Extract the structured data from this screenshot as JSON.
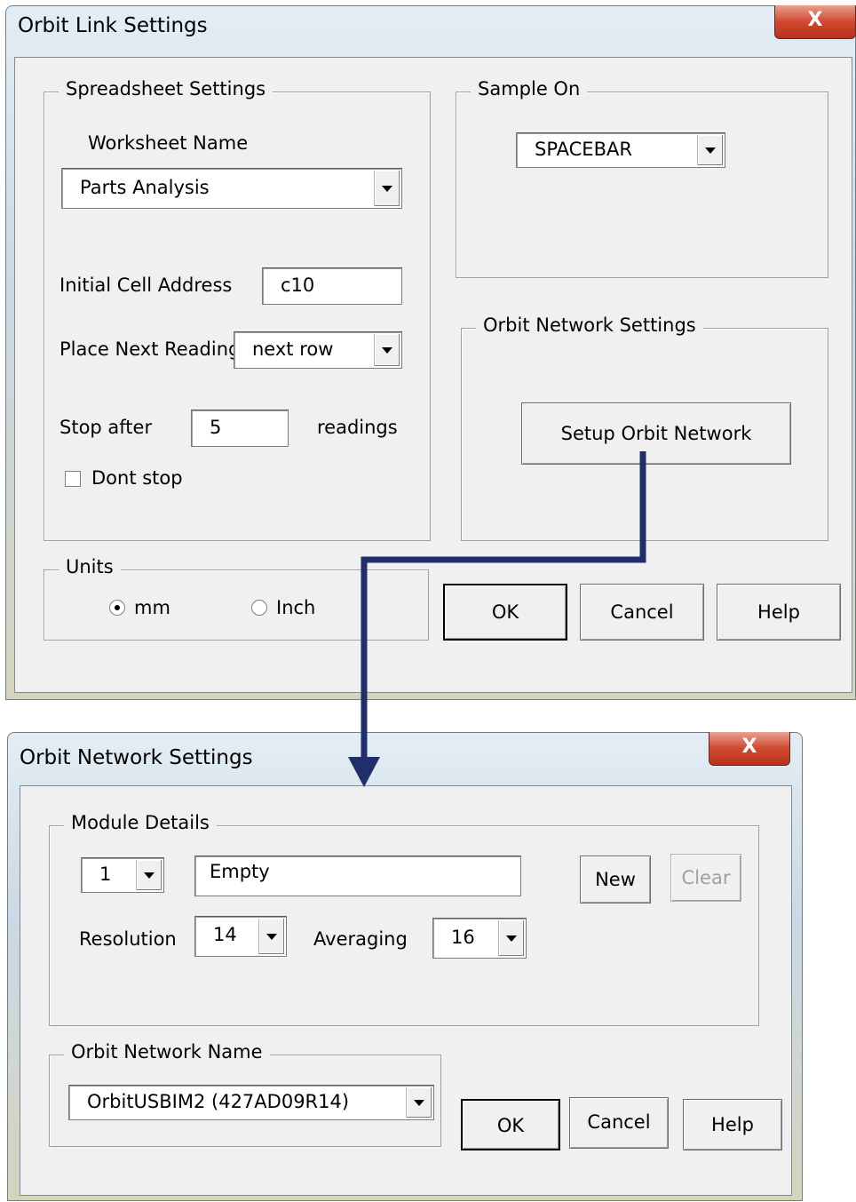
{
  "link_dialog": {
    "title": "Orbit Link Settings",
    "close_label": "X",
    "spreadsheet": {
      "legend": "Spreadsheet Settings",
      "worksheet_name_label": "Worksheet Name",
      "worksheet_name_value": "Parts Analysis",
      "initial_cell_label": "Initial Cell Address",
      "initial_cell_value": "c10",
      "place_next_label": "Place Next Reading",
      "place_next_value": "next row",
      "stop_after_label": "Stop after",
      "stop_after_value": "5",
      "readings_label": "readings",
      "dont_stop_label": "Dont stop",
      "dont_stop_checked": false
    },
    "sample_on": {
      "legend": "Sample On",
      "value": "SPACEBAR"
    },
    "network": {
      "legend": "Orbit Network Settings",
      "setup_button": "Setup Orbit Network"
    },
    "units": {
      "legend": "Units",
      "mm_label": "mm",
      "inch_label": "Inch",
      "selected": "mm"
    },
    "buttons": {
      "ok": "OK",
      "cancel": "Cancel",
      "help": "Help"
    }
  },
  "network_dialog": {
    "title": "Orbit Network Settings",
    "close_label": "X",
    "module": {
      "legend": "Module Details",
      "module_number": "1",
      "module_name": "Empty",
      "new_button": "New",
      "clear_button": "Clear",
      "resolution_label": "Resolution",
      "resolution_value": "14",
      "averaging_label": "Averaging",
      "averaging_value": "16"
    },
    "network_name": {
      "legend": "Orbit Network Name",
      "value": "OrbitUSBIM2 (427AD09R14)"
    },
    "buttons": {
      "ok": "OK",
      "cancel": "Cancel",
      "help": "Help"
    }
  },
  "colors": {
    "connector_arrow": "#1f2f6b",
    "dialog_face": "#f0f0f0",
    "close_button": "#c8412a"
  }
}
